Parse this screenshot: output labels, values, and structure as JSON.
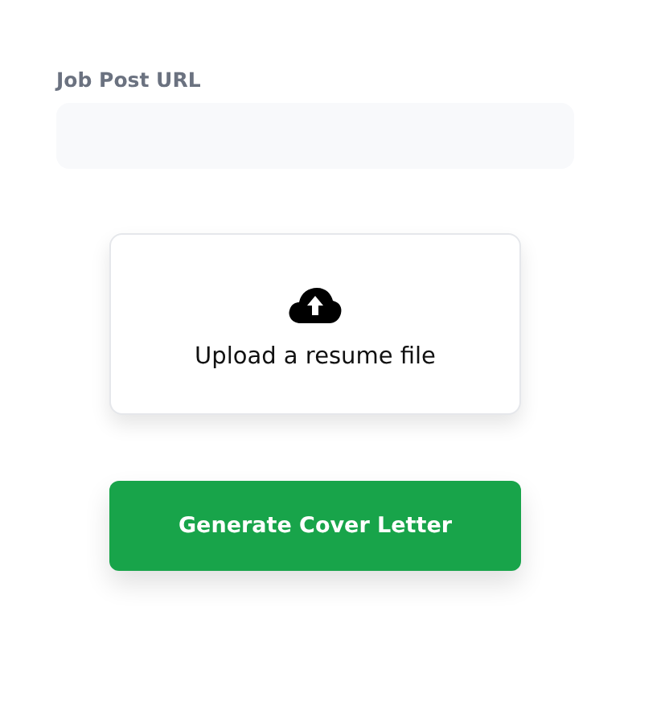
{
  "job_url_field": {
    "label": "Job Post URL"
  },
  "upload": {
    "text": "Upload a resume file"
  },
  "generate_button": {
    "label": "Generate Cover Letter"
  }
}
